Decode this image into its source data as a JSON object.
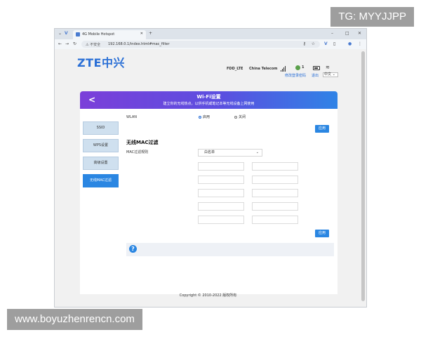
{
  "watermarks": {
    "top_right": "TG: MYYJJPP",
    "bottom_left": "www.boyuzhenrencn.com"
  },
  "browser": {
    "tab_title": "4G Mobile Hotspot",
    "new_tab": "+",
    "not_secure": "不安全",
    "url": "192.168.0.1/index.html#mac_filter"
  },
  "router": {
    "brand": "ZTE中兴",
    "network": "FDD_LTE",
    "carrier": "China Telecom",
    "signal_label": "1",
    "links": {
      "change_password": "修改登录密码",
      "logout": "退出"
    },
    "language": "中文"
  },
  "banner": {
    "back": "<",
    "title": "Wi-Fi设置",
    "subtitle": "建立你的无线热点，以供手机或笔记本等无线设备上网使用"
  },
  "sidebar": [
    {
      "label": "SSID"
    },
    {
      "label": "WPS设置"
    },
    {
      "label": "高级设置"
    },
    {
      "label": "无线MAC过滤"
    }
  ],
  "wlan": {
    "label": "WLAN",
    "enable": "启用",
    "disable": "关闭",
    "selected": "enable"
  },
  "apply_label": "应用",
  "mac_section": {
    "title": "无线MAC过滤",
    "rule_label": "MAC过滤规则",
    "rule_value": "白名单"
  },
  "help_icon": "?",
  "footer": {
    "copyright": "Copyright © 2010-2022 版权所有"
  },
  "colors": {
    "accent": "#2a86e2",
    "banner_start": "#7b3fd9",
    "banner_end": "#2f83e6",
    "brand": "#2a6fd6"
  }
}
